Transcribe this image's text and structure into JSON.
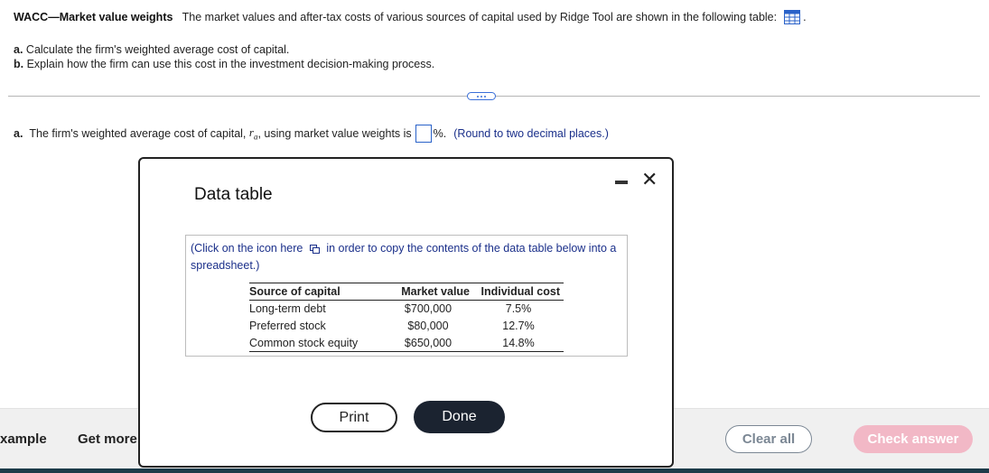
{
  "problem": {
    "title": "WACC—Market value weights",
    "intro": "The market values and after-tax costs of various sources of capital used by Ridge Tool  are shown in the following table:",
    "period": ".",
    "tasks": [
      {
        "letter": "a.",
        "text": "Calculate the firm's weighted average cost of capital."
      },
      {
        "letter": "b.",
        "text": "Explain how the firm can use this cost in the investment decision-making process."
      }
    ]
  },
  "answer": {
    "letter": "a.",
    "prefix": "The firm's weighted average cost of capital,",
    "var": "r",
    "sub": "a",
    "mid": ", using market value weights is",
    "value": "",
    "suffix": "%.",
    "hint": "(Round to two decimal places.)"
  },
  "modal": {
    "title": "Data table",
    "copy_note_pre": "(Click on the icon  here",
    "copy_note_post": "in order to copy the contents of the data table below into a spreadsheet.)",
    "columns": [
      "Source of capital",
      "Market value",
      "Individual cost"
    ],
    "rows": [
      [
        "Long-term debt",
        "$700,000",
        "7.5%"
      ],
      [
        "Preferred stock",
        "$80,000",
        "12.7%"
      ],
      [
        "Common stock equity",
        "$650,000",
        "14.8%"
      ]
    ],
    "print_label": "Print",
    "done_label": "Done",
    "close_glyph": "✕"
  },
  "footer": {
    "example_label": "xample",
    "get_more_label": "Get more",
    "clear_label": "Clear all",
    "check_label": "Check answer"
  },
  "colors": {
    "link_blue": "#1a2f8a",
    "accent_blue": "#2a62c9",
    "check_pink": "#f2b8c6",
    "done_dark": "#1b2330"
  }
}
